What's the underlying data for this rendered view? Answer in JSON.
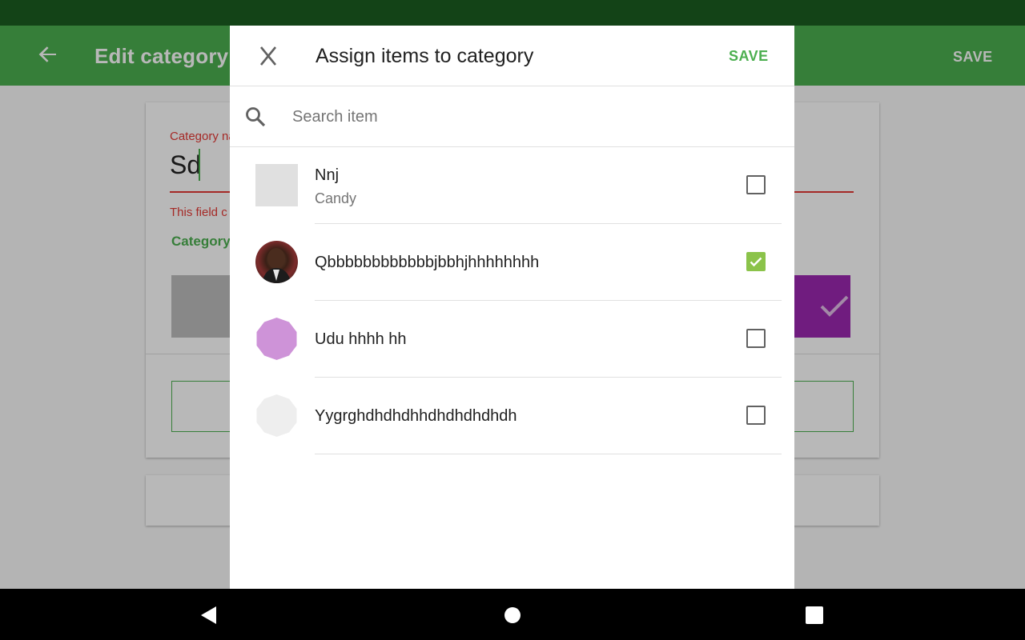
{
  "background": {
    "appbar": {
      "title": "Edit category",
      "save_label": "SAVE"
    },
    "category_name_label": "Category na",
    "category_name_value": "Sd",
    "error_text": "This field c",
    "section_label": "Category"
  },
  "dialog": {
    "title": "Assign items to category",
    "save_label": "SAVE",
    "search": {
      "placeholder": "Search item",
      "value": ""
    },
    "items": [
      {
        "name": "Nnj",
        "category": "Candy",
        "thumb": "grey-square",
        "checked": false
      },
      {
        "name": "Qbbbbbbbbbbbbjbbhjhhhhhhhh",
        "category": "",
        "thumb": "photo-avatar",
        "checked": true
      },
      {
        "name": "Udu hhhh hh",
        "category": "",
        "thumb": "purple-octagon",
        "checked": false
      },
      {
        "name": "Yygrghdhdhdhhdhdhdhdhdh",
        "category": "",
        "thumb": "light-grey-octagon",
        "checked": false
      }
    ]
  },
  "colors": {
    "accent": "#4caf50",
    "checkbox_checked": "#8bc34a",
    "error": "#e53935",
    "purple": "#ce93d8",
    "status_bar": "#1b5e20"
  },
  "nav": {
    "back_icon": "back-triangle-icon",
    "home_icon": "home-circle-icon",
    "recents_icon": "recents-square-icon"
  }
}
